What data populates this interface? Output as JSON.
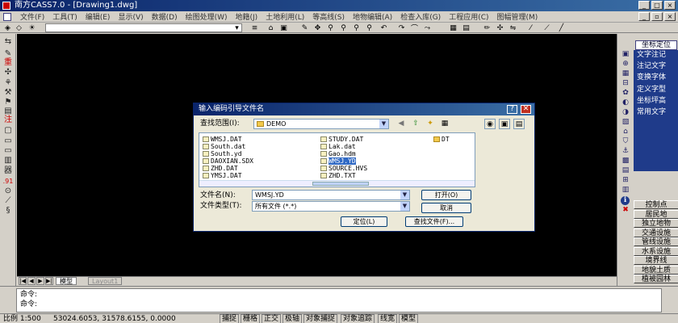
{
  "titlebar": {
    "title": "南方CASS7.0 - [Drawing1.dwg]"
  },
  "menu": [
    "文件(F)",
    "工具(T)",
    "编辑(E)",
    "显示(V)",
    "数据(D)",
    "绘图处理(W)",
    "地籍(J)",
    "土地利用(L)",
    "等高线(S)",
    "地物编辑(A)",
    "检查入库(G)",
    "工程应用(C)",
    "图幅管理(M)"
  ],
  "left_icons": [
    "⇆",
    "✎",
    "重",
    "✣",
    "⚘",
    "⚒",
    "⚑",
    "▤",
    "注",
    "▢",
    "▭",
    "▭",
    "▥",
    "器",
    ".91",
    "⊙",
    "⟋",
    "§"
  ],
  "layout": {
    "tabs": [
      "模型",
      "Layout1"
    ],
    "nav": [
      "|◀",
      "◀",
      "▶",
      "▶|"
    ]
  },
  "right_palette": {
    "title": "坐标定位",
    "items": [
      "文字注记",
      "注记文字",
      "变换字体",
      "定义字型",
      "坐标坪高",
      "常用文字"
    ],
    "buttons": [
      "控制点",
      "居民地",
      "独立地物",
      "交通设施",
      "管线设施",
      "水系设施",
      "境界线",
      "地貌土质",
      "植被园林"
    ],
    "icons": [
      "▣",
      "⊕",
      "▦",
      "⊟",
      "✿",
      "◐",
      "◑",
      "▧",
      "⌂",
      "⛉",
      "⚓",
      "▩",
      "▤",
      "⊞",
      "▥",
      "ℹ",
      "✖"
    ]
  },
  "command": {
    "lines": [
      "命令:",
      "命令:"
    ]
  },
  "status": {
    "scale": "比例 1:500",
    "coords": "53024.6053, 31578.6155, 0.0000",
    "toggles": [
      "捕捉",
      "栅格",
      "正交",
      "极轴",
      "对象捕捉",
      "对象追踪",
      "线宽",
      "模型"
    ]
  },
  "dialog": {
    "title": "输入编码引导文件名",
    "help": "?",
    "close": "✕",
    "lookin_label": "查找范围(I):",
    "lookin_value": "DEMO",
    "files": [
      {
        "name": "WMSJ.DAT",
        "kind": "file",
        "selected": false
      },
      {
        "name": "South.dat",
        "kind": "file",
        "selected": false
      },
      {
        "name": "South.yd",
        "kind": "file",
        "selected": false
      },
      {
        "name": "DAOXIAN.SDX",
        "kind": "file",
        "selected": false
      },
      {
        "name": "ZHD.DAT",
        "kind": "file",
        "selected": false
      },
      {
        "name": "YMSJ.DAT",
        "kind": "file",
        "selected": false
      },
      {
        "name": "STUDY.DAT",
        "kind": "file",
        "selected": false
      },
      {
        "name": "Lak.dat",
        "kind": "file",
        "selected": false
      },
      {
        "name": "Gao.hdm",
        "kind": "file",
        "selected": false
      },
      {
        "name": "WMSJ.YD",
        "kind": "file",
        "selected": true
      },
      {
        "name": "SOURCE.HVS",
        "kind": "file",
        "selected": false
      },
      {
        "name": "ZHD.TXT",
        "kind": "file",
        "selected": false
      },
      {
        "name": "DT",
        "kind": "folder",
        "selected": false
      }
    ],
    "filename_label": "文件名(N):",
    "filename_value": "WMSJ.YD",
    "filetype_label": "文件类型(T):",
    "filetype_value": "所有文件 (*.*)",
    "open_button": "打开(O)",
    "cancel_button": "取消",
    "locate_button": "定位(L)",
    "find_button": "查找文件(F)..."
  }
}
